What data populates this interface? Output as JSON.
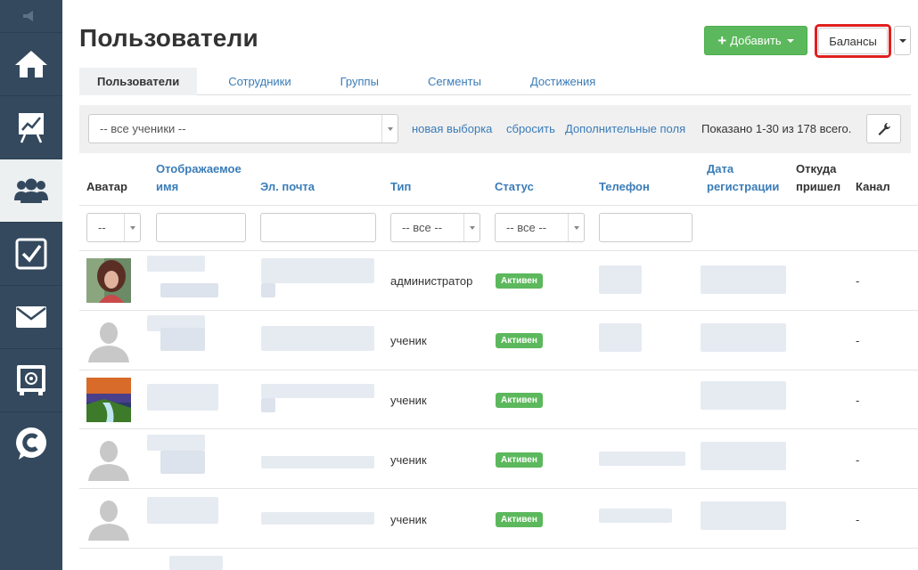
{
  "sidebar": {
    "items": [
      {
        "icon": "home-icon"
      },
      {
        "icon": "chart-icon"
      },
      {
        "icon": "users-icon",
        "active": true
      },
      {
        "icon": "checkbox-icon"
      },
      {
        "icon": "mail-icon"
      },
      {
        "icon": "safe-icon"
      },
      {
        "icon": "chat-logo-icon"
      }
    ]
  },
  "header": {
    "title": "Пользователи",
    "add_button": "Добавить",
    "balances_button": "Балансы"
  },
  "tabs": [
    "Пользователи",
    "Сотрудники",
    "Группы",
    "Сегменты",
    "Достижения"
  ],
  "filterbar": {
    "selection_value": "-- все ученики --",
    "new_selection": "новая выборка",
    "reset": "сбросить",
    "extra_fields": "Дополнительные поля",
    "shown": "Показано 1-30 из 178 всего."
  },
  "table": {
    "headers": {
      "avatar": "Аватар",
      "name_line1": "Отображаемое",
      "name_line2": "имя",
      "email": "Эл. почта",
      "type": "Тип",
      "status": "Статус",
      "phone": "Телефон",
      "reg_line1": "Дата",
      "reg_line2": "регистрации",
      "source_line1": "Откуда",
      "source_line2": "пришел",
      "channel": "Канал"
    },
    "filters": {
      "avatar": "--",
      "type": "-- все --",
      "status": "-- все --"
    },
    "rows": [
      {
        "type": "администратор",
        "status": "Активен",
        "channel": "-"
      },
      {
        "type": "ученик",
        "status": "Активен",
        "channel": "-"
      },
      {
        "type": "ученик",
        "status": "Активен",
        "channel": "-"
      },
      {
        "type": "ученик",
        "status": "Активен",
        "channel": "-"
      },
      {
        "type": "ученик",
        "status": "Активен",
        "channel": "-"
      }
    ]
  },
  "colors": {
    "sidebar": "#34495e",
    "primary_green": "#5cb85c",
    "link_blue": "#3a7cb8",
    "highlight_red": "#e0201f"
  }
}
